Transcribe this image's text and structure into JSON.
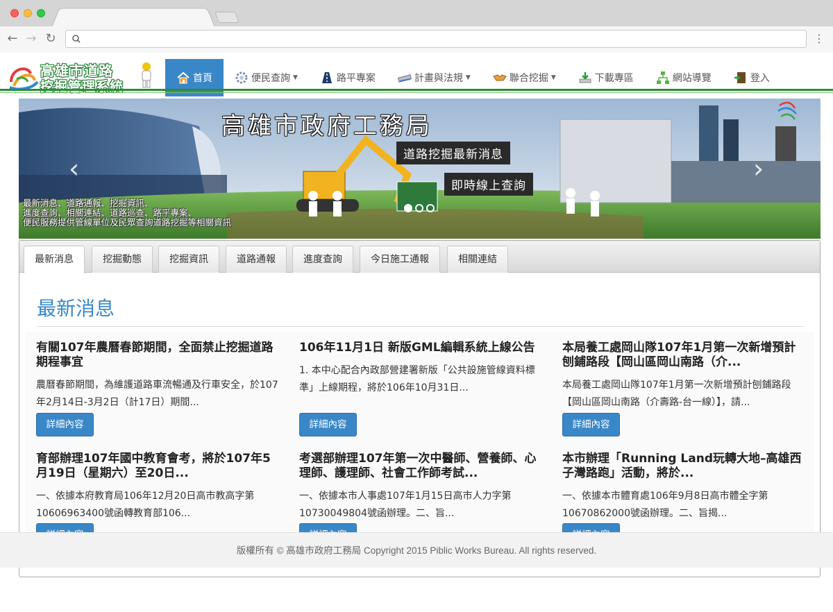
{
  "header": {
    "logo_line1": "高雄市道路",
    "logo_line2": "挖掘管理系統"
  },
  "nav": {
    "items": [
      {
        "label": "首頁",
        "icon": "home-icon",
        "active": true
      },
      {
        "label": "便民查詢",
        "icon": "gear-icon",
        "dropdown": true
      },
      {
        "label": "路平專案",
        "icon": "road-icon"
      },
      {
        "label": "計畫與法規",
        "icon": "ruler-icon",
        "dropdown": true
      },
      {
        "label": "聯合挖掘",
        "icon": "handshake-icon",
        "dropdown": true
      },
      {
        "label": "下載專區",
        "icon": "download-icon"
      },
      {
        "label": "網站導覽",
        "icon": "sitemap-icon"
      },
      {
        "label": "登入",
        "icon": "door-icon"
      }
    ]
  },
  "banner": {
    "title": "高雄市政府工務局",
    "button1": "道路挖掘最新消息",
    "button2": "即時線上查詢",
    "text_line1": "最新消息、道路通報、挖掘資訊、",
    "text_line2": "進度查詢、相關連結、道路巡查、路平專案、",
    "text_line3": "便民服務提供管線單位及民眾查詢道路挖掘等相關資訊",
    "prev": "‹",
    "next": "›"
  },
  "tabs": [
    "最新消息",
    "挖掘動態",
    "挖掘資訊",
    "道路通報",
    "進度查詢",
    "今日施工通報",
    "相關連結"
  ],
  "section_title": "最新消息",
  "news": [
    {
      "title": "有關107年農曆春節期間，全面禁止挖掘道路期程事宜",
      "body": "農曆春節期間，為維護道路車流暢通及行車安全，於107年2月14日-3月2日（計17日）期間..."
    },
    {
      "title": "106年11月1日 新版GML編輯系統上線公告",
      "body": "1. 本中心配合內政部營建署新版「公共設施管線資料標準」上線期程，將於106年10月31日..."
    },
    {
      "title": "本局養工處岡山隊107年1月第一次新增預計刨鋪路段【岡山區岡山南路（介...",
      "body": "本局養工處岡山隊107年1月第一次新增預計刨鋪路段【岡山區岡山南路（介壽路-台一線）】，請..."
    },
    {
      "title": "育部辦理107年國中教育會考，將於107年5月19日（星期六）至20日...",
      "body": "一、依據本府教育局106年12月20日高市教高字第10606963400號函轉教育部106..."
    },
    {
      "title": "考選部辦理107年第一次中醫師、營養師、心理師、護理師、社會工作師考試...",
      "body": "一、依據本市人事處107年1月15日高市人力字第10730049804號函辦理。二、旨..."
    },
    {
      "title": "本市辦理「Running Land玩轉大地–高雄西子灣路跑」活動，將於...",
      "body": "一、依據本市體育處106年9月8日高市體全字第10670862000號函辦理。二、旨揭..."
    }
  ],
  "detail_label": "詳細內容",
  "footer": "版權所有 © 高雄市政府工務局 Copyright 2015 Piblic Works Bureau. All rights reserved.",
  "colors": {
    "accent": "#3a87c8",
    "brand_green": "#2e8b3a"
  }
}
